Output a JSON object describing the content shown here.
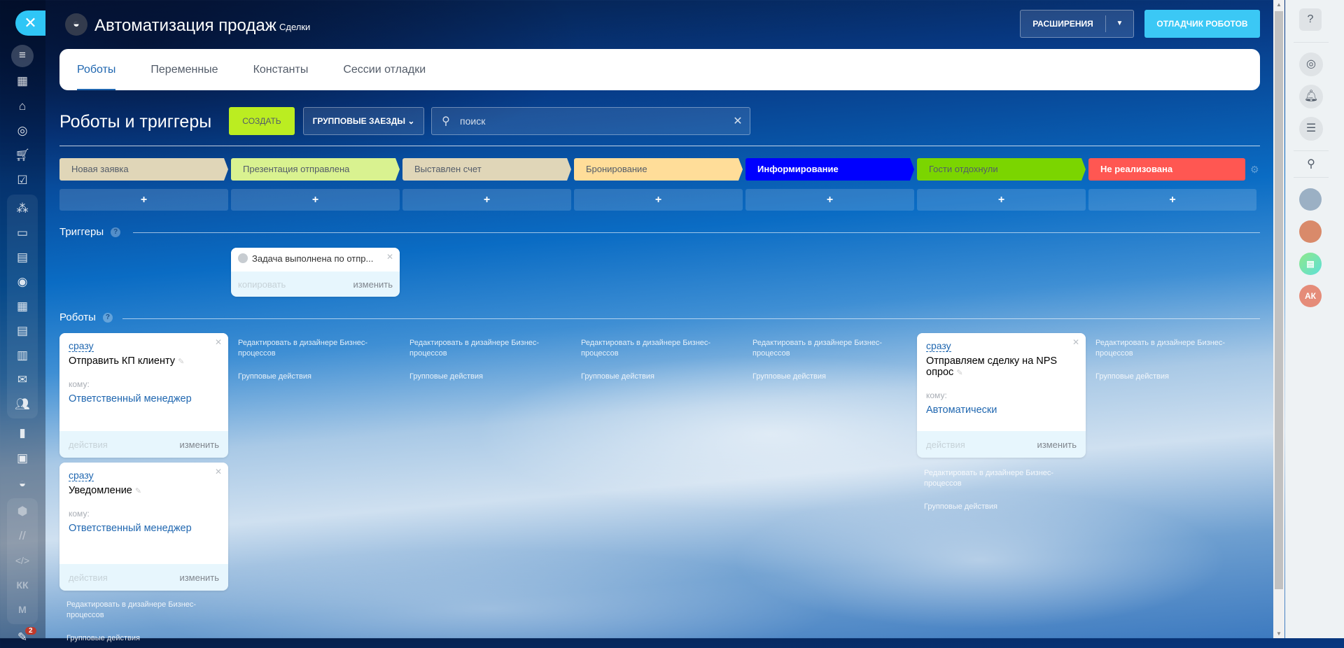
{
  "header": {
    "title": "Автоматизация продаж",
    "subtitle": "Сделки",
    "extensions_label": "РАСШИРЕНИЯ",
    "debugger_label": "ОТЛАДЧИК РОБОТОВ"
  },
  "tabs": [
    {
      "label": "Роботы"
    },
    {
      "label": "Переменные"
    },
    {
      "label": "Константы"
    },
    {
      "label": "Сессии отладки"
    }
  ],
  "toolbar": {
    "title": "Роботы и триггеры",
    "create_label": "СОЗДАТЬ",
    "group_label": "ГРУППОВЫЕ ЗАЕЗДЫ",
    "search_placeholder": "поиск"
  },
  "stages": [
    {
      "label": "Новая заявка",
      "color": "#e0d6b8",
      "text": "#535c69"
    },
    {
      "label": "Презентация отправлена",
      "color": "#d9f290",
      "text": "#535c69"
    },
    {
      "label": "Выставлен счет",
      "color": "#e0d6b8",
      "text": "#535c69"
    },
    {
      "label": "Бронирование",
      "color": "#ffdd99",
      "text": "#535c69"
    },
    {
      "label": "Информирование",
      "color": "#0000ff",
      "text": "#ffffff"
    },
    {
      "label": "Гости отдохнули",
      "color": "#7bd500",
      "text": "#535c69"
    },
    {
      "label": "Не реализована",
      "color": "#ff5752",
      "text": "#ffffff"
    }
  ],
  "add_label": "+",
  "triggers": {
    "heading": "Триггеры",
    "card": {
      "title": "Задача выполнена по отпр...",
      "copy": "копировать",
      "edit": "изменить"
    }
  },
  "robots": {
    "heading": "Роботы",
    "cards": [
      {
        "when": "сразу",
        "title": "Отправить КП клиенту",
        "to_label": "кому:",
        "to": "Ответственный менеджер",
        "actions": "действия",
        "edit": "изменить"
      },
      {
        "when": "сразу",
        "title": "Уведомление",
        "to_label": "кому:",
        "to": "Ответственный менеджер",
        "actions": "действия",
        "edit": "изменить"
      },
      {
        "when": "сразу",
        "title": "Отправляем сделку на NPS опрос",
        "to_label": "кому:",
        "to": "Автоматически",
        "actions": "действия",
        "edit": "изменить"
      }
    ],
    "edit_designer": "Редактировать в дизайнере Бизнес-процессов",
    "group_actions": "Групповые действия"
  },
  "sidebar": {
    "badge": "2",
    "kk": "КК",
    "m": "М"
  },
  "right": {
    "avatar_initials": "АК"
  }
}
